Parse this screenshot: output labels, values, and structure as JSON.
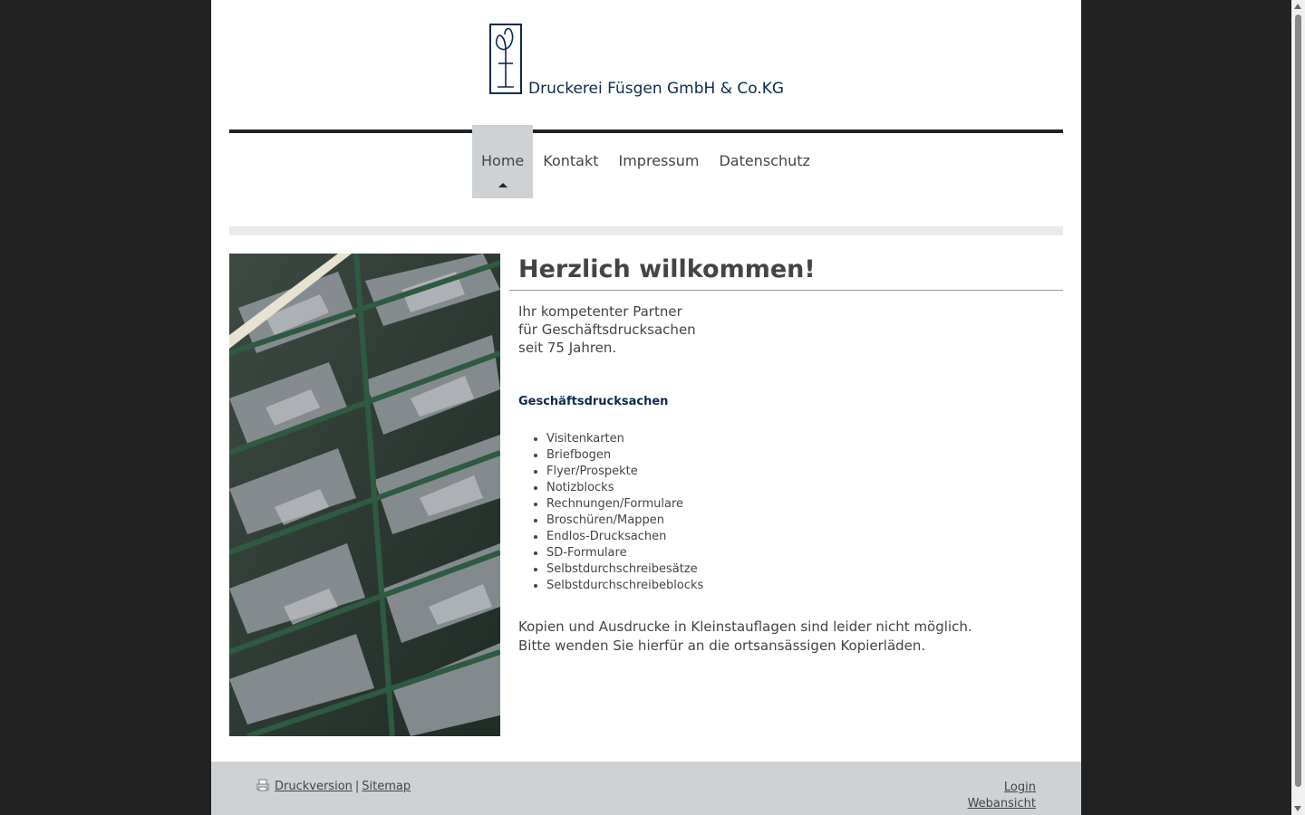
{
  "header": {
    "company_name": "Druckerei Füsgen GmbH & Co.KG",
    "logo_icon": "fuesgen-monogram-logo"
  },
  "nav": {
    "items": [
      {
        "label": "Home",
        "active": true
      },
      {
        "label": "Kontakt",
        "active": false
      },
      {
        "label": "Impressum",
        "active": false
      },
      {
        "label": "Datenschutz",
        "active": false
      }
    ]
  },
  "main": {
    "image_icon": "letterpress-type-case-photo",
    "heading": "Herzlich willkommen!",
    "intro_lines": [
      "Ihr kompetenter Partner",
      "für Geschäftsdrucksachen",
      "seit 75 Jahren."
    ],
    "subheading": "Geschäftsdrucksachen",
    "services": [
      "Visitenkarten",
      "Briefbogen",
      "Flyer/Prospekte",
      "Notizblocks",
      "Rechnungen/Formulare",
      "Broschüren/Mappen",
      "Endlos-Drucksachen",
      "SD-Formulare",
      "Selbstdurchschreibesätze",
      "Selbstdurchschreibeblocks"
    ],
    "notice_lines": [
      "Kopien und Ausdrucke in Kleinstauflagen sind leider nicht möglich.",
      "Bitte wenden Sie hierfür an die ortsansässigen Kopierläden."
    ]
  },
  "footer": {
    "print_label": " Druckversion ",
    "separator": "|",
    "sitemap_label": "Sitemap",
    "login_label": "Login",
    "webview_label": "Webansicht"
  },
  "colors": {
    "outer_background": "#222222",
    "page_background": "#ffffff",
    "nav_active": "#cfd2d5",
    "brand_blue": "#0d2a50",
    "footer_background": "#cfd2d5"
  }
}
